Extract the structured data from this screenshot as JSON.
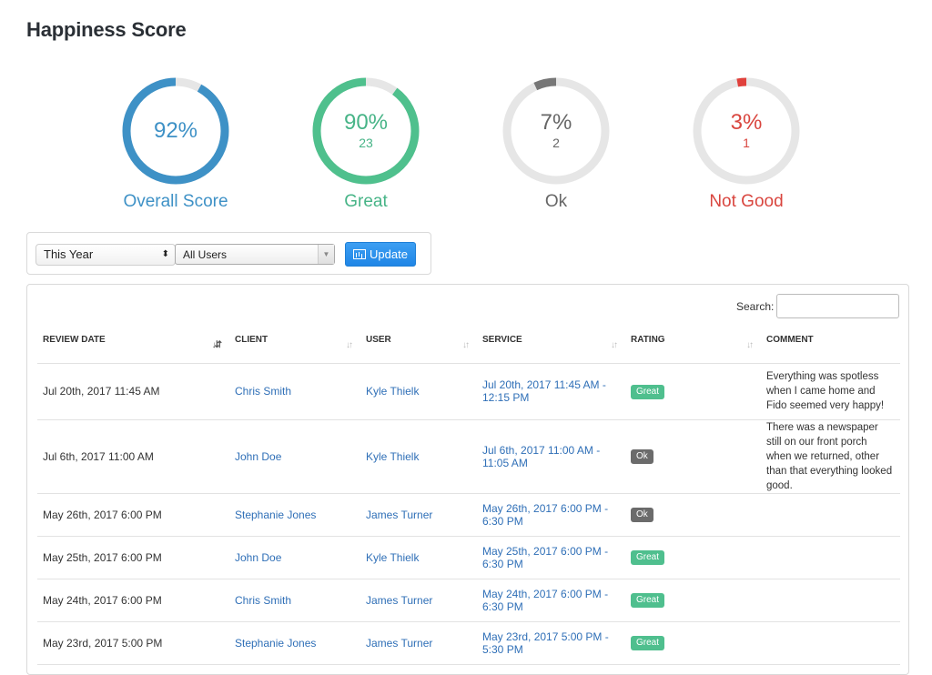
{
  "page": {
    "title": "Happiness Score"
  },
  "gauges": [
    {
      "percent": "92%",
      "count": "",
      "label": "Overall Score",
      "value": 0.92,
      "color": "#3e91c6",
      "text_color": "#3e91c6"
    },
    {
      "percent": "90%",
      "count": "23",
      "label": "Great",
      "value": 0.9,
      "color": "#4fc08d",
      "text_color": "#47b487"
    },
    {
      "percent": "7%",
      "count": "2",
      "label": "Ok",
      "value": 0.07,
      "color": "#777777",
      "text_color": "#666666"
    },
    {
      "percent": "3%",
      "count": "1",
      "label": "Not Good",
      "value": 0.03,
      "color": "#e0413c",
      "text_color": "#d9463f"
    }
  ],
  "filters": {
    "period": "This Year",
    "period_arrows": "⬍",
    "users": "All Users",
    "users_drop": "▼",
    "update_label": "Update"
  },
  "search": {
    "label": "Search:",
    "value": ""
  },
  "table": {
    "headers": [
      "REVIEW DATE",
      "CLIENT",
      "USER",
      "SERVICE",
      "RATING",
      "COMMENT"
    ],
    "sort_icons": [
      "↓⇵",
      "↓↑",
      "↓↑",
      "↓↑",
      "↓↑"
    ],
    "rows": [
      {
        "date": "Jul 20th, 2017 11:45 AM",
        "client": "Chris Smith",
        "user": "Kyle Thielk",
        "service": "Jul 20th, 2017 11:45 AM - 12:15 PM",
        "rating": "Great",
        "comment": "Everything was spotless when I came home and Fido seemed very happy!"
      },
      {
        "date": "Jul 6th, 2017 11:00 AM",
        "client": "John Doe",
        "user": "Kyle Thielk",
        "service": "Jul 6th, 2017 11:00 AM - 11:05 AM",
        "rating": "Ok",
        "comment": "There was a newspaper still on our front porch when we returned, other than that everything looked good."
      },
      {
        "date": "May 26th, 2017 6:00 PM",
        "client": "Stephanie Jones",
        "user": "James Turner",
        "service": "May 26th, 2017 6:00 PM - 6:30 PM",
        "rating": "Ok",
        "comment": ""
      },
      {
        "date": "May 25th, 2017 6:00 PM",
        "client": "John Doe",
        "user": "Kyle Thielk",
        "service": "May 25th, 2017 6:00 PM - 6:30 PM",
        "rating": "Great",
        "comment": ""
      },
      {
        "date": "May 24th, 2017 6:00 PM",
        "client": "Chris Smith",
        "user": "James Turner",
        "service": "May 24th, 2017 6:00 PM - 6:30 PM",
        "rating": "Great",
        "comment": ""
      },
      {
        "date": "May 23rd, 2017 5:00 PM",
        "client": "Stephanie Jones",
        "user": "James Turner",
        "service": "May 23rd, 2017 5:00 PM - 5:30 PM",
        "rating": "Great",
        "comment": ""
      }
    ]
  },
  "rating_colors": {
    "Great": "#4fbf8e",
    "Ok": "#6b6b6b"
  }
}
